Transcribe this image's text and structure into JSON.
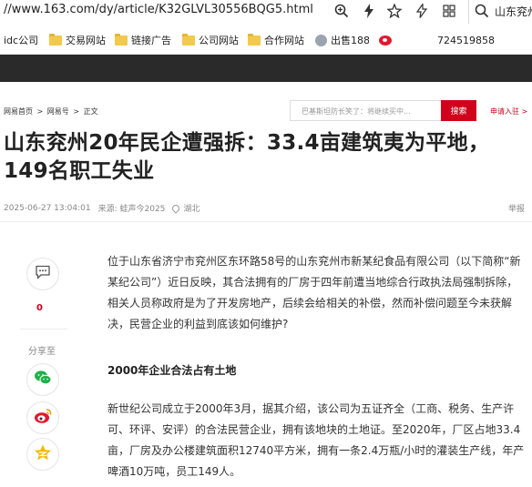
{
  "browser": {
    "url": "//www.163.com/dy/article/K32GLVL30556BQG5.html",
    "search_text": "山东兖州"
  },
  "bookmarks": [
    {
      "label": "idc公司",
      "icon": "none"
    },
    {
      "label": "交易网站",
      "icon": "folder-icon"
    },
    {
      "label": "链接广告",
      "icon": "folder-icon"
    },
    {
      "label": "公司网站",
      "icon": "folder-icon"
    },
    {
      "label": "合作网站",
      "icon": "folder-icon"
    },
    {
      "label": "出售188",
      "icon": "globe-icon"
    },
    {
      "label": "",
      "icon": "weibo-icon"
    },
    {
      "label": "724519858",
      "icon": "none"
    }
  ],
  "breadcrumb": [
    "网易首页",
    ">",
    "网易号",
    ">",
    "正文"
  ],
  "site_search": {
    "placeholder": "巴基斯坦防长笑了：将继续买中...",
    "button": "搜索",
    "signup": "申请入驻 >"
  },
  "article": {
    "title": "山东兖州20年民企遭强拆：33.4亩建筑夷为平地，149名职工失业",
    "date": "2025-06-27 13:04:01",
    "source": "来源: 蛙声今2025",
    "location": "湖北",
    "report": "举报",
    "para1": "位于山东省济宁市兖州区东环路58号的山东兖州市新某纪食品有限公司（以下简称“新某纪公司”）近日反映，其合法拥有的厂房于四年前遭当地综合行政执法局强制拆除，相关人员称政府是为了开发房地产，后续会给相关的补偿，然而补偿问题至今未获解决，民营企业的利益到底该如何维护?",
    "subhead": "2000年企业合法占有土地",
    "para2": "新世纪公司成立于2000年3月，据其介绍，该公司为五证齐全（工商、税务、生产许可、环评、安评）的合法民营企业，拥有该地块的土地证。至2020年，厂区占地33.4亩，厂房及办公楼建筑面积12740平方米，拥有一条2.4万瓶/小时的灌装生产线，年产啤酒10万吨，员工149人。"
  },
  "social": {
    "comment_count": "0",
    "share_label": "分享至",
    "share_icons": [
      "wechat-icon",
      "weibo-icon",
      "qzone-icon"
    ]
  },
  "colors": {
    "accent_red": "#d0021b",
    "nav_dark": "#2a2a2a",
    "wechat_green": "#20b14a",
    "weibo_red": "#e6162d",
    "qzone_yellow": "#f5b800"
  }
}
